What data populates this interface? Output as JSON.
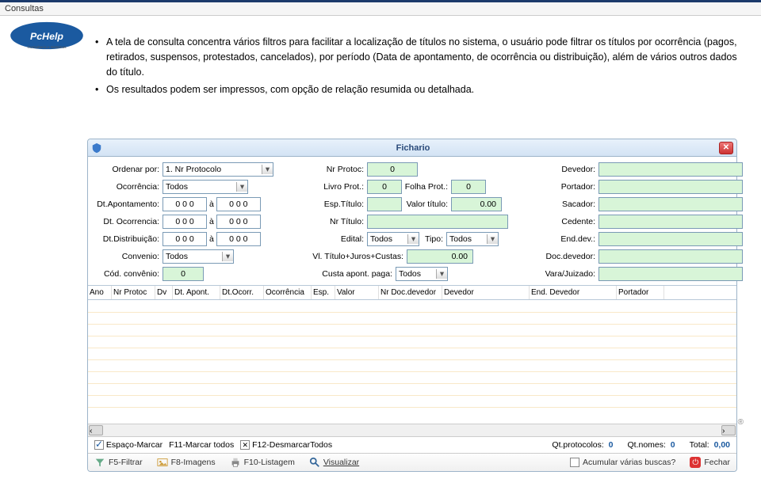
{
  "slide": {
    "header": "Consultas",
    "bullets": [
      "A tela de consulta concentra vários filtros para facilitar a localização de títulos no sistema, o usuário pode filtrar os títulos por ocorrência (pagos, retirados, suspensos, protestados, cancelados), por período (Data de apontamento, de ocorrência ou distribuição), além de vários outros dados do título.",
      "Os resultados podem ser impressos, com opção de relação resumida ou detalhada."
    ]
  },
  "window": {
    "title": "Fichario",
    "filters": {
      "col1": {
        "ordenar_lbl": "Ordenar por:",
        "ordenar_val": "1. Nr Protocolo",
        "ocorrencia_lbl": "Ocorrência:",
        "ocorrencia_val": "Todos",
        "dtapont_lbl": "Dt.Apontamento:",
        "dtapont_a": "0 0 0",
        "dtapont_b": "0 0 0",
        "dtocor_lbl": "Dt. Ocorrencia:",
        "dtocor_a": "0 0 0",
        "dtocor_b": "0 0 0",
        "dtdist_lbl": "Dt.Distribuição:",
        "dtdist_a": "0 0 0",
        "dtdist_b": "0 0 0",
        "convenio_lbl": "Convenio:",
        "convenio_val": "Todos",
        "codconv_lbl": "Cód. convênio:",
        "codconv_val": "0",
        "a": "à"
      },
      "col2": {
        "nrprot_lbl": "Nr Protoc:",
        "nrprot_val": "0",
        "livro_lbl": "Livro Prot.:",
        "livro_val": "0",
        "folha_lbl": "Folha Prot.:",
        "folha_val": "0",
        "esp_lbl": "Esp.Título:",
        "valor_lbl": "Valor título:",
        "valor_val": "0.00",
        "nrtit_lbl": "Nr Título:",
        "edital_lbl": "Edital:",
        "edital_val": "Todos",
        "tipo_lbl": "Tipo:",
        "tipo_val": "Todos",
        "vljuros_lbl": "Vl. Título+Juros+Custas:",
        "vljuros_val": "0.00",
        "custa_lbl": "Custa apont. paga:",
        "custa_val": "Todos"
      },
      "col3": {
        "devedor_lbl": "Devedor:",
        "portador_lbl": "Portador:",
        "sacador_lbl": "Sacador:",
        "cedente_lbl": "Cedente:",
        "enddev_lbl": "End.dev.:",
        "docdev_lbl": "Doc.devedor:",
        "vara_lbl": "Vara/Juizado:"
      }
    },
    "columns": [
      "Ano",
      "Nr Protoc",
      "Dv",
      "Dt. Apont.",
      "Dt.Ocorr.",
      "Ocorrência",
      "Esp.",
      "Valor",
      "Nr Doc.devedor",
      "Devedor",
      "End. Devedor",
      "Portador"
    ],
    "status": {
      "espaco": "Espaço-Marcar",
      "f11": "F11-Marcar todos",
      "f12": "F12-DesmarcarTodos",
      "qtp_lbl": "Qt.protocolos:",
      "qtp_val": "0",
      "qtn_lbl": "Qt.nomes:",
      "qtn_val": "0",
      "tot_lbl": "Total:",
      "tot_val": "0,00"
    },
    "footer": {
      "f5": "F5-Filtrar",
      "f8": "F8-Imagens",
      "f10": "F10-Listagem",
      "vis": "Visualizar",
      "acum": "Acumular várias buscas?",
      "fechar": "Fechar"
    }
  }
}
